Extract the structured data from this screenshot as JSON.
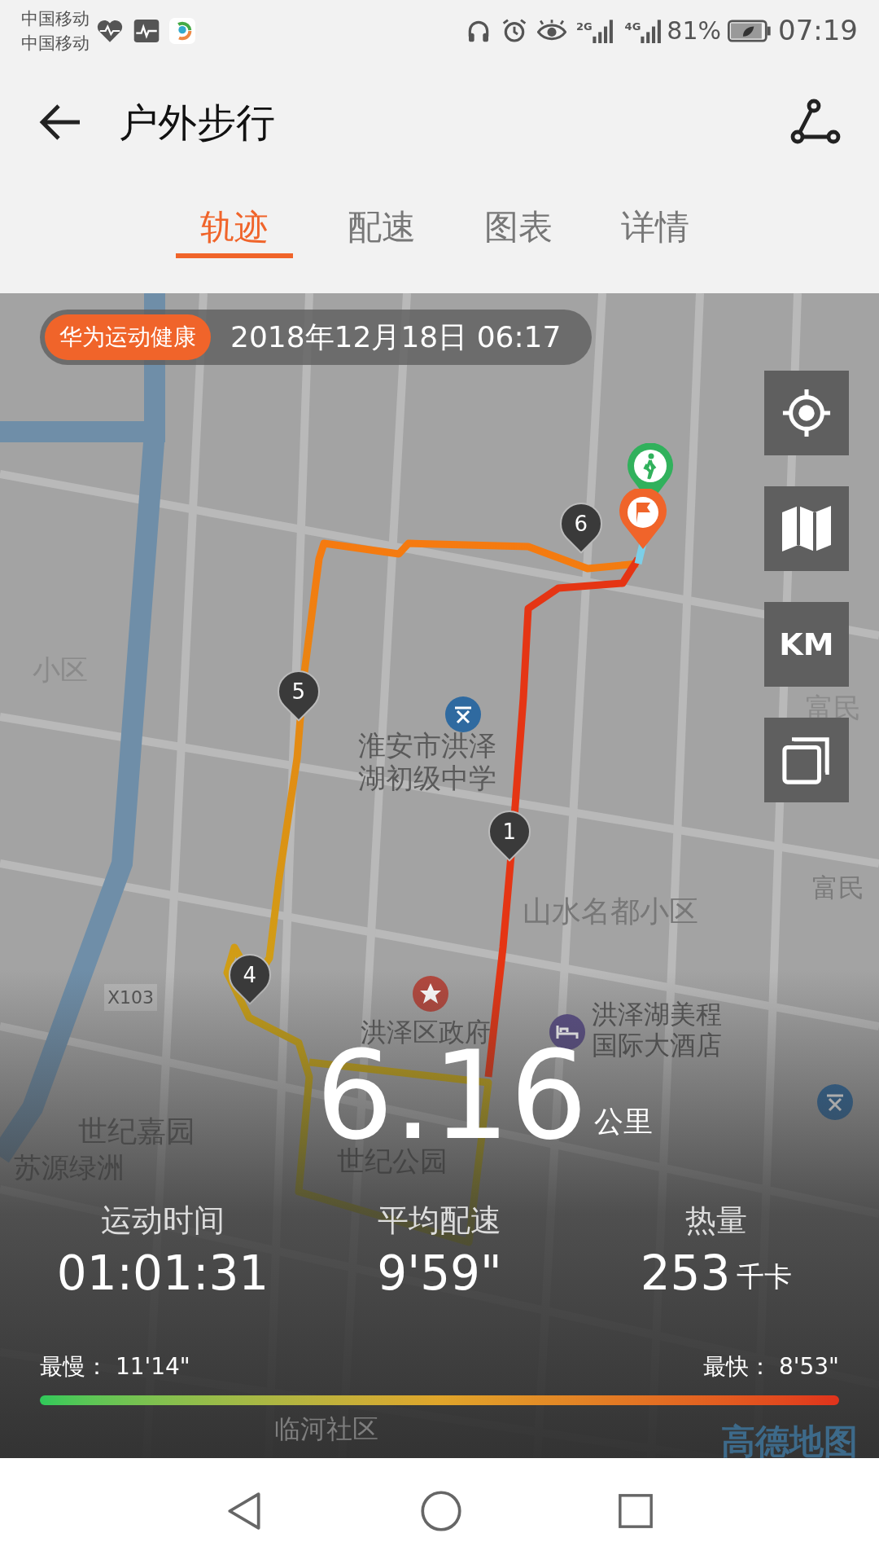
{
  "status_bar": {
    "carriers": [
      "中国移动",
      "中国移动"
    ],
    "network": [
      "2G",
      "4G"
    ],
    "battery": "81%",
    "time": "07:19"
  },
  "header": {
    "title": "户外步行"
  },
  "tabs": [
    {
      "label": "轨迹",
      "selected": true
    },
    {
      "label": "配速",
      "selected": false
    },
    {
      "label": "图表",
      "selected": false
    },
    {
      "label": "详情",
      "selected": false
    }
  ],
  "map": {
    "source_badge": "华为运动健康",
    "date": "2018年12月18日 06:17",
    "unit_button": "KM",
    "labels": [
      "小区",
      "淮安市洪泽",
      "湖初级中学",
      "富民",
      "富民",
      "山水名都小区",
      "X103",
      "洪泽区政府",
      "洪泽湖美程",
      "国际大酒店",
      "世纪嘉园",
      "世纪公园",
      "苏源绿洲",
      "临河社区"
    ],
    "km_markers": [
      "6",
      "5",
      "1",
      "4"
    ],
    "provider": "高德地图"
  },
  "summary": {
    "distance": "6.16",
    "unit": "公里",
    "stats": [
      {
        "label": "运动时间",
        "value": "01:01:31"
      },
      {
        "label": "平均配速",
        "value": "9'59\""
      },
      {
        "label": "热量",
        "value": "253",
        "unit": "千卡"
      }
    ]
  },
  "pace_range": {
    "slowest_label": "最慢：",
    "slowest": "11'14\"",
    "fastest_label": "最快：",
    "fastest": "8'53\""
  }
}
